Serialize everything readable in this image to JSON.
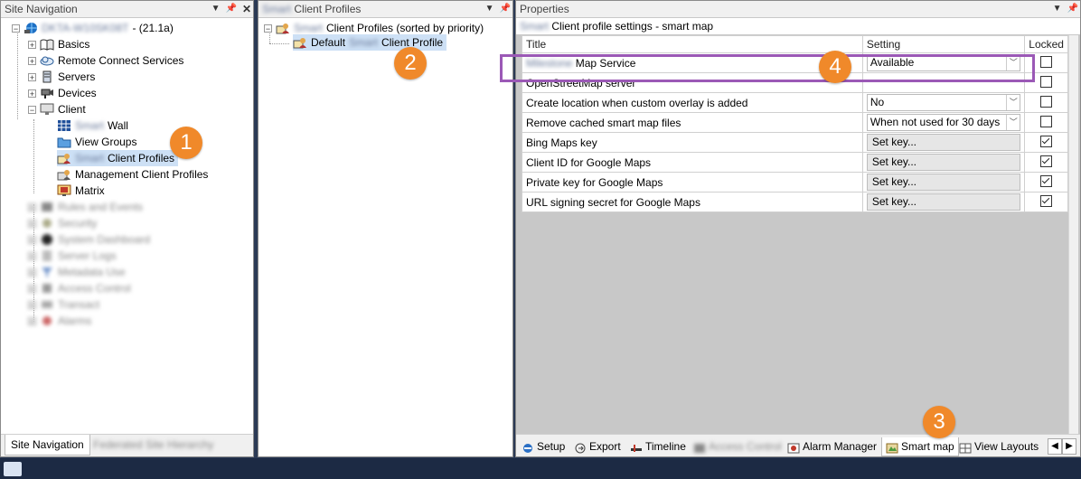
{
  "site_nav": {
    "title": "Site Navigation",
    "root_name": "DKTA-W10SK08T",
    "root_version": "- (21.1a)",
    "items": [
      "Basics",
      "Remote Connect Services",
      "Servers",
      "Devices",
      "Client"
    ],
    "client_children": {
      "wall_prefix": "Smart",
      "wall": "Wall",
      "view_groups": "View Groups",
      "profiles_prefix": "Smart",
      "profiles": "Client Profiles",
      "mgmt_profiles": "Management Client Profiles",
      "matrix": "Matrix"
    },
    "blurred_items": [
      "Rules and Events",
      "Security",
      "System Dashboard",
      "Server Logs",
      "Metadata Use",
      "Access Control",
      "Transact",
      "Alarms"
    ],
    "tab_active": "Site Navigation",
    "tab_other": "Federated Site Hierarchy"
  },
  "profiles_pane": {
    "title_prefix": "Smart",
    "title": "Client Profiles",
    "root_prefix": "Smart",
    "root": "Client Profiles (sorted by priority)",
    "child_default": "Default",
    "child_prefix": "Smart",
    "child_suffix": "Client Profile"
  },
  "properties": {
    "title": "Properties",
    "subtitle_prefix": "Smart",
    "subtitle": "Client profile settings - smart map",
    "columns": [
      "Title",
      "Setting",
      "Locked"
    ],
    "rows": [
      {
        "title_prefix": "Milestone",
        "title": "Map Service",
        "setting": "Available",
        "type": "dropdown",
        "locked": false
      },
      {
        "title": "OpenStreetMap server",
        "setting": "",
        "type": "text",
        "locked": false
      },
      {
        "title": "Create location when custom overlay is added",
        "setting": "No",
        "type": "dropdown",
        "locked": false
      },
      {
        "title": "Remove cached smart map files",
        "setting": "When not used for 30 days",
        "type": "dropdown",
        "locked": false
      },
      {
        "title": "Bing Maps key",
        "setting": "Set key...",
        "type": "button",
        "locked": true
      },
      {
        "title": "Client ID for Google Maps",
        "setting": "Set key...",
        "type": "button",
        "locked": true
      },
      {
        "title": "Private key for Google Maps",
        "setting": "Set key...",
        "type": "button",
        "locked": true
      },
      {
        "title": "URL signing secret for Google Maps",
        "setting": "Set key...",
        "type": "button",
        "locked": true
      }
    ],
    "tabs": [
      "Setup",
      "Export",
      "Timeline",
      "Access Control",
      "Alarm Manager",
      "Smart map",
      "View Layouts"
    ]
  },
  "callouts": [
    "1",
    "2",
    "3",
    "4"
  ],
  "colors": {
    "callout": "#f0892a",
    "highlight_box": "#9b59b6",
    "selection": "#cde0f5"
  }
}
